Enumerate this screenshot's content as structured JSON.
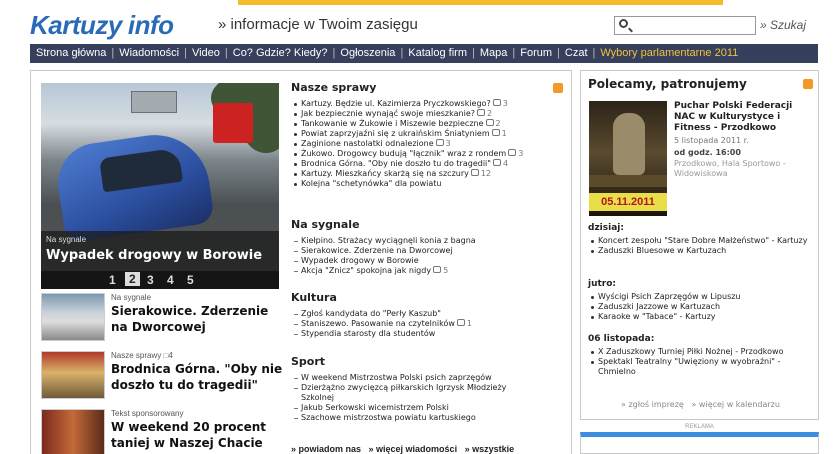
{
  "header": {
    "logo_main": "Kartuzy",
    "logo_sub": "info",
    "tagline": "» informacje w Twoim zasięgu",
    "search_placeholder": "",
    "search_button": "» Szukaj"
  },
  "nav": {
    "items": [
      "Strona główna",
      "Wiadomości",
      "Video",
      "Co? Gdzie? Kiedy?",
      "Ogłoszenia",
      "Katalog firm",
      "Mapa",
      "Forum",
      "Czat"
    ],
    "highlight": "Wybory parlamentarne 2011",
    "highlight_color": "#f3c23a",
    "bar_color": "#363f5c"
  },
  "hero": {
    "category": "Na sygnale",
    "title": "Wypadek drogowy w Borowie",
    "pages": [
      "1",
      "2",
      "3",
      "4",
      "5"
    ],
    "active_page": "2"
  },
  "stories": [
    {
      "category": "Na sygnale",
      "comments": "",
      "title": "Sierakowice. Zderzenie na Dworcowej"
    },
    {
      "category": "Nasze sprawy",
      "comments": "4",
      "title": "Brodnica Górna. \"Oby nie doszło tu do tragedii\""
    },
    {
      "category": "Tekst sponsorowany",
      "comments": "",
      "title": "W weekend 20 procent taniej w Naszej Chacie"
    }
  ],
  "sections": {
    "nasze_sprawy": {
      "heading": "Nasze sprawy",
      "items": [
        {
          "text": "Kartuzy. Będzie ul. Kazimierza Pryczkowskiego?",
          "comments": "3"
        },
        {
          "text": "Jak bezpiecznie wynająć swoje mieszkanie?",
          "comments": "2"
        },
        {
          "text": "Tankowanie w Żukowie i Miszewie bezpieczne",
          "comments": "2"
        },
        {
          "text": "Powiat zaprzyjaźni się z ukraińskim Śniatyniem",
          "comments": "1"
        },
        {
          "text": "Zaginione nastolatki odnalezione",
          "comments": "3"
        },
        {
          "text": "Żukowo. Drogowcy budują \"łącznik\" wraz z rondem",
          "comments": "3"
        },
        {
          "text": "Brodnica Górna. \"Oby nie doszło tu do tragedii\"",
          "comments": "4"
        },
        {
          "text": "Kartuzy. Mieszkańcy skarżą się na szczury",
          "comments": "12"
        },
        {
          "text": "Kolejna \"schetynówka\" dla powiatu",
          "comments": ""
        }
      ]
    },
    "na_sygnale": {
      "heading": "Na sygnale",
      "items": [
        {
          "text": "Kiełpino. Strażacy wyciągnęli konia z bagna",
          "comments": ""
        },
        {
          "text": "Sierakowice. Zderzenie na Dworcowej",
          "comments": ""
        },
        {
          "text": "Wypadek drogowy w Borowie",
          "comments": ""
        },
        {
          "text": "Akcja \"Znicz\" spokojna jak nigdy",
          "comments": "5"
        }
      ]
    },
    "kultura": {
      "heading": "Kultura",
      "items": [
        {
          "text": "Zgłoś kandydata do \"Perły Kaszub\"",
          "comments": ""
        },
        {
          "text": "Staniszewo. Pasowanie na czytelników",
          "comments": "1"
        },
        {
          "text": "Stypendia starosty dla studentów",
          "comments": ""
        }
      ]
    },
    "sport": {
      "heading": "Sport",
      "items": [
        {
          "text": "W weekend Mistrzostwa Polski psich zaprzęgów",
          "comments": ""
        },
        {
          "text": "Dzierżążno zwycięzcą piłkarskich Igrzysk Młodzieży",
          "comments": ""
        },
        {
          "text": "Szkolnej",
          "comments": "",
          "continuation": true
        },
        {
          "text": "Jakub Serkowski wicemistrzem Polski",
          "comments": ""
        },
        {
          "text": "Szachowe mistrzostwa powiatu kartuskiego",
          "comments": ""
        }
      ]
    }
  },
  "more_links": {
    "notify": "» powiadom nas",
    "more_news": "» więcej wiadomości",
    "all": "» wszystkie"
  },
  "right": {
    "heading": "Polecamy, patronujemy",
    "poster_date": "05.11.2011",
    "event": {
      "title": "Puchar Polski Federacji NAC w Kulturystyce i Fitness - Przodkowo",
      "date": "5 listopada 2011 r.",
      "time": "od godz. 16:00",
      "location": "Przodkowo, Hala Sportowo - Widowiskowa"
    },
    "today_label": "dzisiaj:",
    "today": [
      "Koncert zespołu \"Stare Dobre Małżeństwo\" - Kartuzy",
      "Zaduszki Bluesowe w Kartuzach"
    ],
    "tomorrow_label": "jutro:",
    "tomorrow": [
      "Wyścigi Psich Zaprzęgów w Lipuszu",
      "Zaduszki Jazzowe w Kartuzach",
      "Karaoke w \"Tabace\" - Kartuzy"
    ],
    "nov6_label": "06 listopada:",
    "nov6": [
      "X Zaduszkowy Turniej Piłki Nożnej - Przodkowo",
      "Spektakl Teatralny \"Uwięziony w wyobraźni\" - Chmielno"
    ],
    "footer_add": "» zgłoś imprezę",
    "footer_more": "» więcej w kalendarzu"
  },
  "ad_label": "REKLAMA"
}
